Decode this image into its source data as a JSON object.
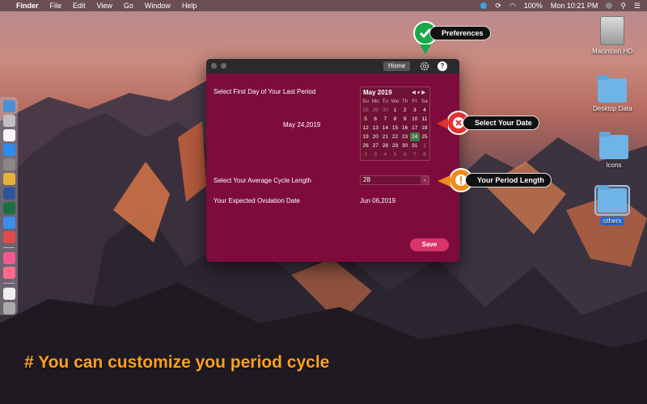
{
  "menubar": {
    "app": "Finder",
    "items": [
      "File",
      "Edit",
      "View",
      "Go",
      "Window",
      "Help"
    ],
    "battery": "100%",
    "clock": "Mon 10:21 PM"
  },
  "desktop": {
    "icons": [
      {
        "label": "Macintosh HD"
      },
      {
        "label": "Desktop Data"
      },
      {
        "label": "Icons"
      },
      {
        "label": "others"
      }
    ]
  },
  "app": {
    "home_label": "Home",
    "help_label": "?",
    "first_day_label": "Select First Day of Your Last Period",
    "selected_date": "May 24,2019",
    "calendar": {
      "month_label": "May 2019",
      "weekdays": [
        "Su",
        "Mo",
        "Tu",
        "We",
        "Th",
        "Fr",
        "Sa"
      ],
      "weeks": [
        [
          "28",
          "29",
          "30",
          "1",
          "2",
          "3",
          "4"
        ],
        [
          "5",
          "6",
          "7",
          "8",
          "9",
          "10",
          "11"
        ],
        [
          "12",
          "13",
          "14",
          "15",
          "16",
          "17",
          "18"
        ],
        [
          "19",
          "20",
          "21",
          "22",
          "23",
          "24",
          "25"
        ],
        [
          "26",
          "27",
          "28",
          "29",
          "30",
          "31",
          "1"
        ],
        [
          "2",
          "3",
          "4",
          "5",
          "6",
          "7",
          "8"
        ]
      ],
      "selected_day": "24"
    },
    "cycle_label": "Select Your Average Cycle Length",
    "cycle_value": "28",
    "ovulation_label": "Your Expected Ovulation Date",
    "ovulation_value": "Jun 06,2019",
    "save_label": "Save"
  },
  "callouts": {
    "preferences": "Preferences",
    "select_date": "Select Your Date",
    "period_length": "Your Period Length"
  },
  "caption": "# You can customize you period cycle",
  "colors": {
    "window_bg": "#7d0c3c",
    "save_button": "#d9336d",
    "caption": "#ffa11d",
    "check_green": "#19a84a",
    "cross_red": "#e0322e",
    "warn_orange": "#f08a1f"
  }
}
